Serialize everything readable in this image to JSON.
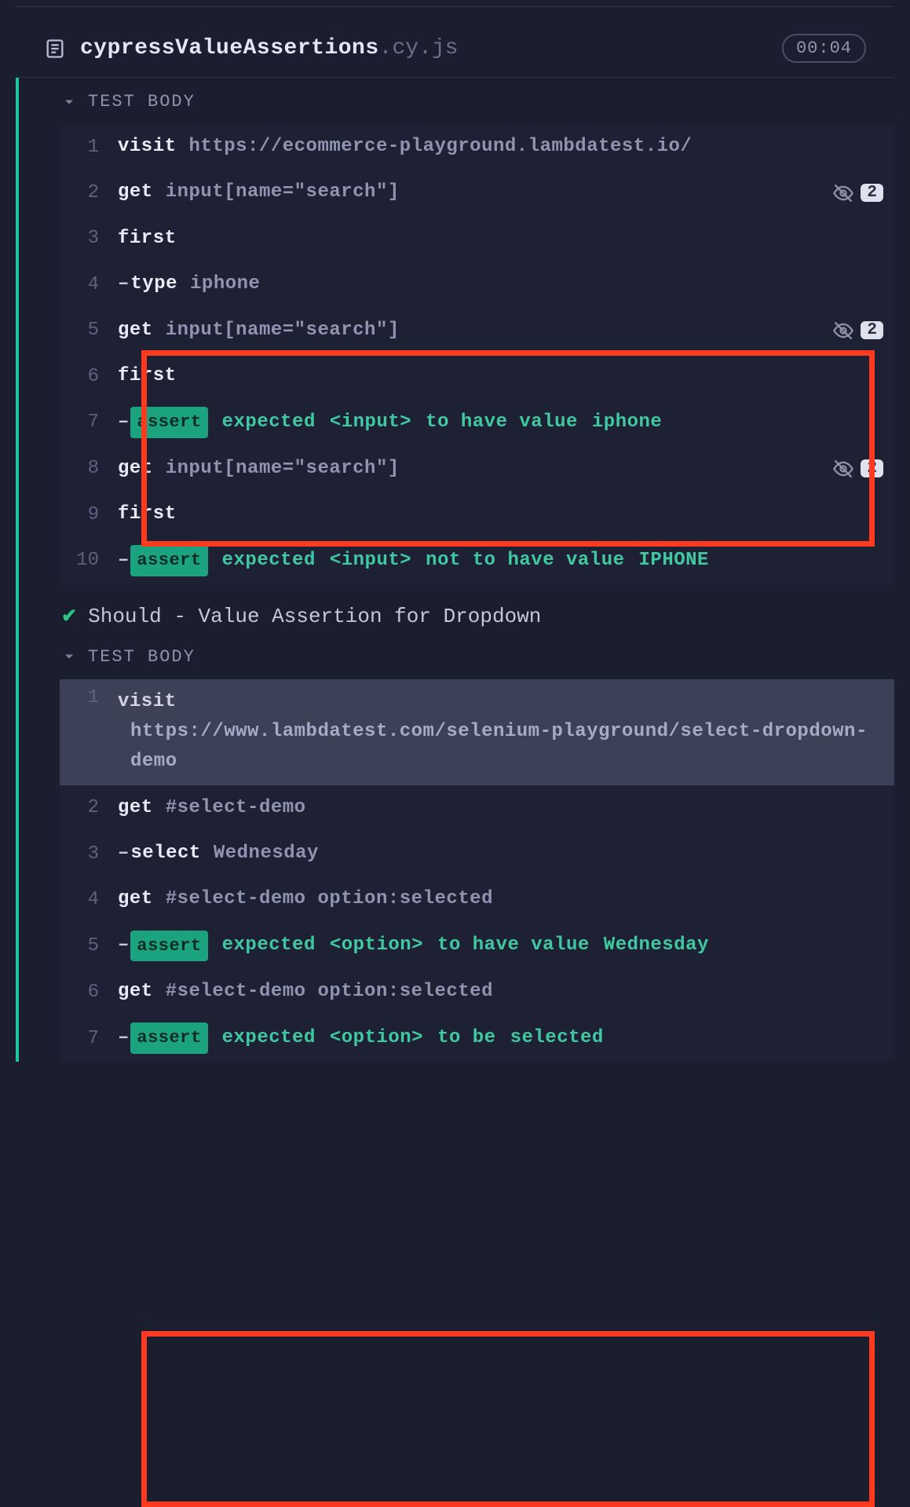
{
  "header": {
    "filename": "cypressValueAssertions",
    "extension": ".cy.js",
    "duration": "00:04"
  },
  "section1": {
    "label": "TEST BODY",
    "rows": [
      {
        "n": "1",
        "cmd": "visit",
        "arg": "https://ecommerce-playground.lambdatest.io/",
        "badges": null
      },
      {
        "n": "2",
        "cmd": "get",
        "arg": "input[name=\"search\"]",
        "badges": "2"
      },
      {
        "n": "3",
        "cmd": "first",
        "arg": "",
        "badges": null
      },
      {
        "n": "4",
        "dash": true,
        "cmd": "type",
        "arg": "iphone",
        "badges": null
      },
      {
        "n": "5",
        "cmd": "get",
        "arg": "input[name=\"search\"]",
        "badges": "2"
      },
      {
        "n": "6",
        "cmd": "first",
        "arg": "",
        "badges": null
      },
      {
        "n": "7",
        "assert": true,
        "parts": [
          "expected",
          "<input>",
          "to have value",
          "iphone"
        ],
        "badges": null
      },
      {
        "n": "8",
        "cmd": "get",
        "arg": "input[name=\"search\"]",
        "badges": "2"
      },
      {
        "n": "9",
        "cmd": "first",
        "arg": "",
        "badges": null
      },
      {
        "n": "10",
        "assert": true,
        "parts": [
          "expected",
          "<input>",
          "not to have value",
          "IPHONE"
        ],
        "badges": null
      }
    ]
  },
  "test2": {
    "title": "Should - Value Assertion for Dropdown"
  },
  "section2": {
    "label": "TEST BODY",
    "rows": [
      {
        "n": "1",
        "cmd": "visit",
        "arg": "https://www.lambdatest.com/selenium-playground/select-dropdown-demo",
        "badges": null,
        "highlight": true
      },
      {
        "n": "2",
        "cmd": "get",
        "arg": "#select-demo",
        "badges": null
      },
      {
        "n": "3",
        "dash": true,
        "cmd": "select",
        "arg": "Wednesday",
        "badges": null
      },
      {
        "n": "4",
        "cmd": "get",
        "arg": "#select-demo option:selected",
        "badges": null
      },
      {
        "n": "5",
        "assert": true,
        "parts": [
          "expected",
          "<option>",
          "to have value",
          "Wednesday"
        ],
        "badges": null
      },
      {
        "n": "6",
        "cmd": "get",
        "arg": "#select-demo option:selected",
        "badges": null
      },
      {
        "n": "7",
        "assert": true,
        "parts": [
          "expected",
          "<option>",
          "to be",
          "selected"
        ],
        "badges": null
      }
    ]
  },
  "icons": {
    "assert_label": "assert",
    "dash": "–"
  }
}
